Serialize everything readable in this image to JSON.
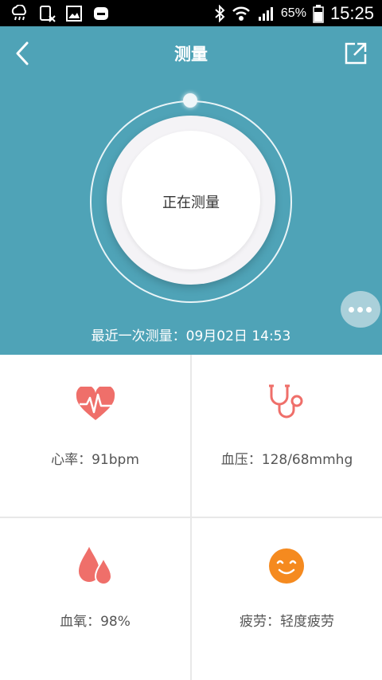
{
  "status_bar": {
    "battery": "65%",
    "time": "15:25"
  },
  "header": {
    "title": "测量",
    "measure_status": "正在测量",
    "recent_label": "最近一次测量：09月02日 14:53"
  },
  "cards": {
    "heart_rate": {
      "label": "心率：91bpm"
    },
    "blood_pressure": {
      "label": "血压：128/68mmhg"
    },
    "blood_oxygen": {
      "label": "血氧：98%"
    },
    "fatigue": {
      "label": "疲劳：轻度疲劳"
    }
  },
  "colors": {
    "header_bg": "#4fa3b7",
    "icon_red": "#ef6f6a",
    "fatigue_orange": "#f58a1f"
  },
  "icons": [
    "cloud-rain-icon",
    "sim-icon",
    "image-icon",
    "app-icon",
    "bluetooth-icon",
    "wifi-icon",
    "signal-icon",
    "battery-icon",
    "back-icon",
    "share-icon",
    "heart-icon",
    "stethoscope-icon",
    "blood-drop-icon",
    "smile-icon"
  ]
}
